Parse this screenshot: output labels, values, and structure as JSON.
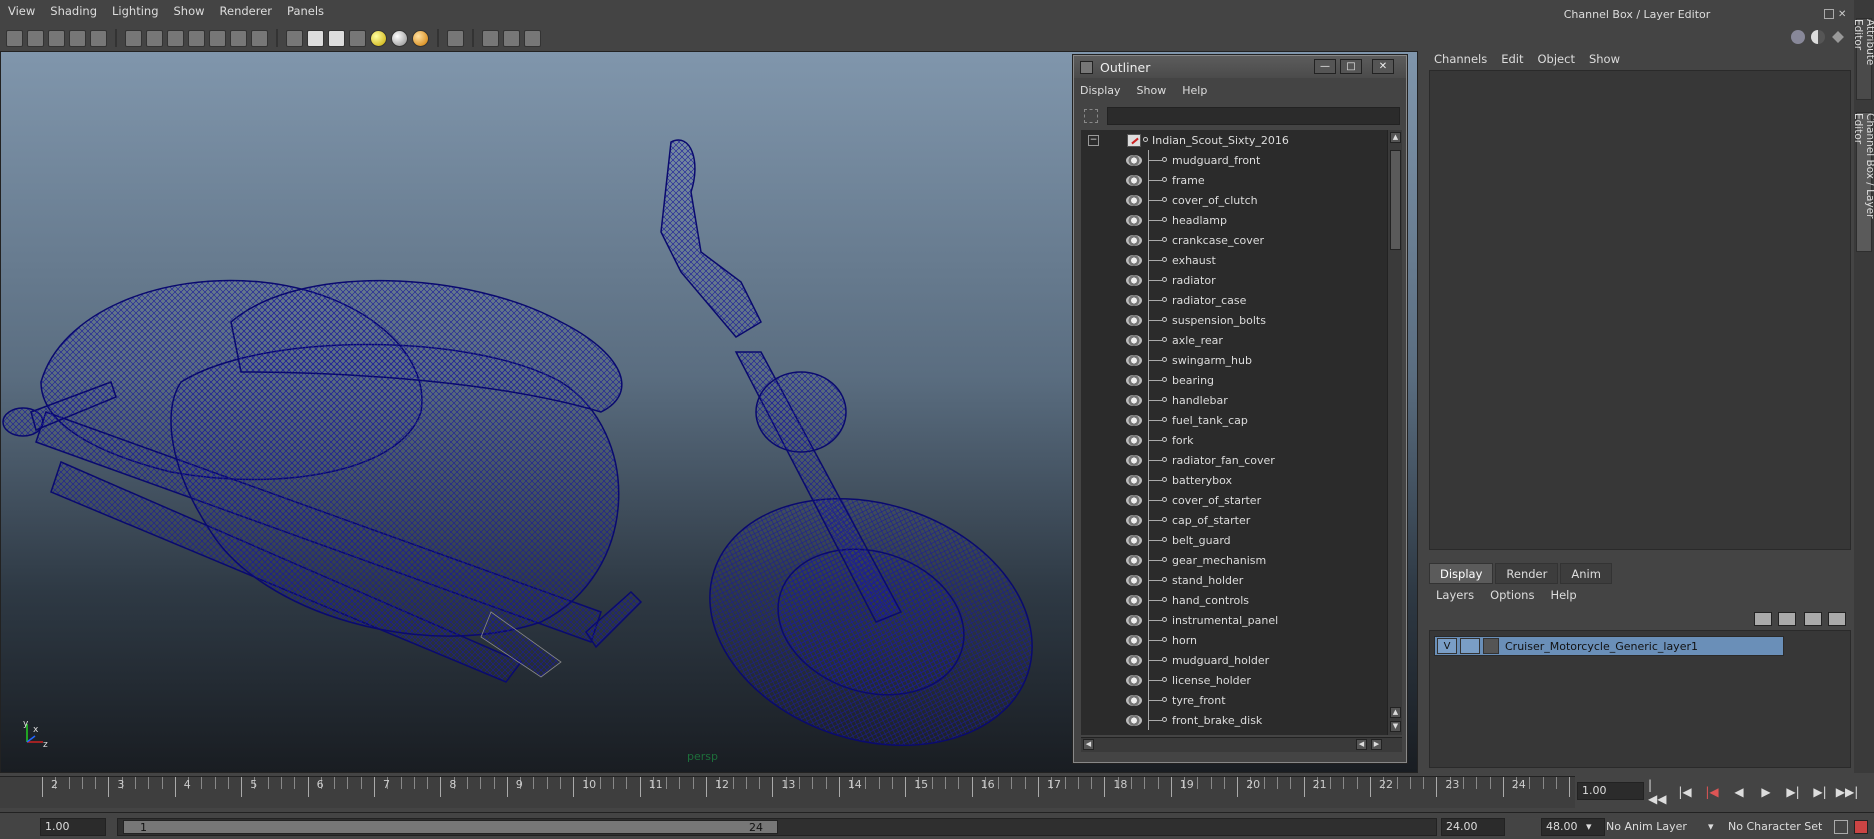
{
  "menubar": {
    "items": [
      "View",
      "Shading",
      "Lighting",
      "Show",
      "Renderer",
      "Panels"
    ]
  },
  "viewport": {
    "camera_label": "persp",
    "axis_x": "x",
    "axis_y": "y",
    "axis_z": "z",
    "wireframe_color": "#0a0a6e"
  },
  "outliner": {
    "title": "Outliner",
    "menu": [
      "Display",
      "Show",
      "Help"
    ],
    "filter_value": "",
    "root": "Indian_Scout_Sixty_2016",
    "items": [
      "mudguard_front",
      "frame",
      "cover_of_clutch",
      "headlamp",
      "crankcase_cover",
      "exhaust",
      "radiator",
      "radiator_case",
      "suspension_bolts",
      "axle_rear",
      "swingarm_hub",
      "bearing",
      "handlebar",
      "fuel_tank_cap",
      "fork",
      "radiator_fan_cover",
      "batterybox",
      "cover_of_starter",
      "cap_of_starter",
      "belt_guard",
      "gear_mechanism",
      "stand_holder",
      "hand_controls",
      "instrumental_panel",
      "horn",
      "mudguard_holder",
      "license_holder",
      "tyre_front",
      "front_brake_disk"
    ]
  },
  "channelbox": {
    "title": "Channel Box / Layer Editor",
    "menu": [
      "Channels",
      "Edit",
      "Object",
      "Show"
    ],
    "tabs": [
      "Display",
      "Render",
      "Anim"
    ],
    "active_tab": "Display",
    "layer_menu": [
      "Layers",
      "Options",
      "Help"
    ],
    "layer": {
      "visibility": "V",
      "name": "Cruiser_Motorcycle_Generic_layer1"
    }
  },
  "sidetabs": [
    "Attribute Editor",
    "Channel Box / Layer Editor"
  ],
  "timeline": {
    "labels": [
      "2",
      "3",
      "4",
      "5",
      "6",
      "7",
      "8",
      "9",
      "10",
      "11",
      "12",
      "13",
      "14",
      "15",
      "16",
      "17",
      "18",
      "19",
      "20",
      "21",
      "22",
      "23",
      "24"
    ],
    "current_frame": "1.00"
  },
  "range": {
    "start_time": "1.00",
    "range_start": "1",
    "range_end": "24",
    "end_time": "24.00",
    "max_time": "48.00",
    "anim_layer": "No Anim Layer",
    "character_set": "No Character Set"
  }
}
